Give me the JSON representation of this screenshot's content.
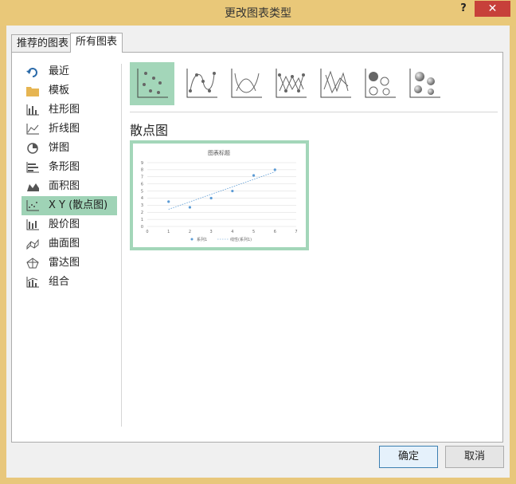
{
  "window": {
    "title": "更改图表类型",
    "help": "?",
    "close": "✕"
  },
  "tabs": [
    {
      "label": "推荐的图表"
    },
    {
      "label": "所有图表"
    }
  ],
  "sidebar": {
    "items": [
      {
        "label": "最近",
        "icon": "recent-icon"
      },
      {
        "label": "模板",
        "icon": "folder-icon"
      },
      {
        "label": "柱形图",
        "icon": "column-chart-icon"
      },
      {
        "label": "折线图",
        "icon": "line-chart-icon"
      },
      {
        "label": "饼图",
        "icon": "pie-chart-icon"
      },
      {
        "label": "条形图",
        "icon": "bar-chart-icon"
      },
      {
        "label": "面积图",
        "icon": "area-chart-icon"
      },
      {
        "label": "X Y (散点图)",
        "icon": "scatter-chart-icon",
        "selected": true
      },
      {
        "label": "股价图",
        "icon": "stock-chart-icon"
      },
      {
        "label": "曲面图",
        "icon": "surface-chart-icon"
      },
      {
        "label": "雷达图",
        "icon": "radar-chart-icon"
      },
      {
        "label": "组合",
        "icon": "combo-chart-icon"
      }
    ]
  },
  "subtypes": [
    {
      "icon": "scatter-markers-icon",
      "selected": true
    },
    {
      "icon": "scatter-smooth-lines-markers-icon"
    },
    {
      "icon": "scatter-smooth-lines-icon"
    },
    {
      "icon": "scatter-straight-lines-markers-icon"
    },
    {
      "icon": "scatter-straight-lines-icon"
    },
    {
      "icon": "bubble-icon"
    },
    {
      "icon": "bubble-3d-icon"
    }
  ],
  "main": {
    "chart_type_title": "散点图"
  },
  "preview_chart": {
    "title": "图表标题",
    "legend_series": "系列1",
    "legend_trend": "线性(系列1)"
  },
  "chart_data": {
    "type": "scatter",
    "title": "图表标题",
    "x": [
      1,
      2,
      3,
      4,
      5,
      6
    ],
    "y": [
      3.5,
      2.7,
      4.0,
      5.0,
      7.2,
      8.0
    ],
    "xlim": [
      0,
      7
    ],
    "ylim": [
      0,
      9
    ],
    "xticks": [
      0,
      1,
      2,
      3,
      4,
      5,
      6,
      7
    ],
    "yticks": [
      0,
      1,
      2,
      3,
      4,
      5,
      6,
      7,
      8,
      9
    ],
    "grid": true,
    "legend": "bottom",
    "series": [
      {
        "name": "系列1"
      }
    ],
    "trendline": {
      "name": "线性(系列1)",
      "type": "linear"
    }
  },
  "buttons": {
    "ok": "确定",
    "cancel": "取消"
  },
  "colors": {
    "selected": "#a3d6b9",
    "marker": "#5b9bd5",
    "close": "#c7403a"
  }
}
